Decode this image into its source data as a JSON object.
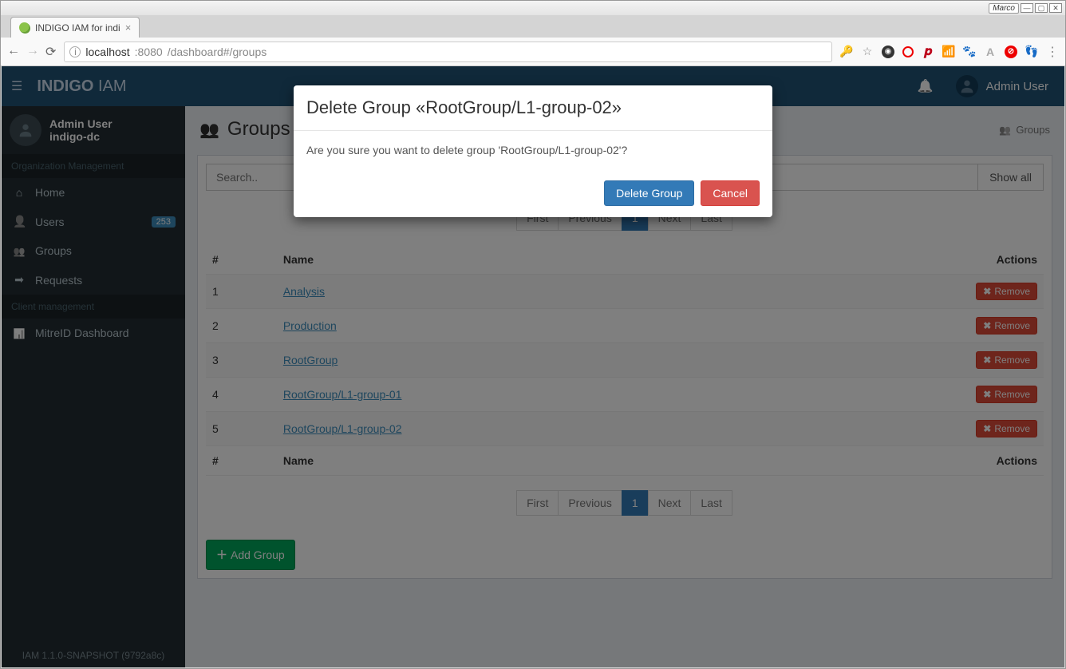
{
  "os_titlebar": {
    "badge": "Marco"
  },
  "browser": {
    "tab_title": "INDIGO IAM for indi",
    "url_host": "localhost",
    "url_port": ":8080",
    "url_path": "/dashboard#/groups"
  },
  "header": {
    "brand_bold": "INDIGO",
    "brand_light": "IAM",
    "username": "Admin User"
  },
  "sidebar": {
    "user_name": "Admin User",
    "org": "indigo-dc",
    "section1": "Organization Management",
    "items1": [
      {
        "label": "Home"
      },
      {
        "label": "Users",
        "badge": "253"
      },
      {
        "label": "Groups"
      },
      {
        "label": "Requests"
      }
    ],
    "section2": "Client management",
    "items2": [
      {
        "label": "MitreID Dashboard"
      }
    ],
    "version": "IAM 1.1.0-SNAPSHOT (9792a8c)"
  },
  "page": {
    "title": "Groups",
    "breadcrumb": "Groups",
    "search_placeholder": "Search..",
    "show_all": "Show all",
    "pagination": {
      "first": "First",
      "prev": "Previous",
      "page": "1",
      "next": "Next",
      "last": "Last"
    },
    "columns": {
      "idx": "#",
      "name": "Name",
      "actions": "Actions"
    },
    "rows": [
      {
        "idx": "1",
        "name": "Analysis"
      },
      {
        "idx": "2",
        "name": "Production"
      },
      {
        "idx": "3",
        "name": "RootGroup"
      },
      {
        "idx": "4",
        "name": "RootGroup/L1-group-01"
      },
      {
        "idx": "5",
        "name": "RootGroup/L1-group-02"
      }
    ],
    "remove_label": "Remove",
    "add_group": "Add Group"
  },
  "modal": {
    "title": "Delete Group «RootGroup/L1-group-02»",
    "body": "Are you sure you want to delete group 'RootGroup/L1-group-02'?",
    "confirm": "Delete Group",
    "cancel": "Cancel"
  }
}
